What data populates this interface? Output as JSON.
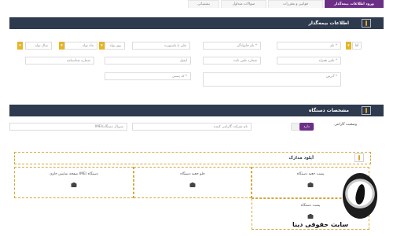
{
  "tabs": [
    {
      "label": "ورود اطلاعات بیمه‌گذار",
      "active": true
    },
    {
      "label": "قوانین و مقررات",
      "active": false
    },
    {
      "label": "سوالات متداول",
      "active": false
    },
    {
      "label": "پشتیبانی",
      "active": false
    }
  ],
  "insurer_section": {
    "title": "اطلاعات بیمه‌گذار",
    "row1": {
      "title_select": "آقا",
      "first_name": "نام *",
      "last_name": "نام خانوادگی *",
      "national_or_passport": "ملی یا پاسپورت",
      "birth_day": "روز تولد",
      "birth_month": "ماه تولد",
      "birth_year": "سال تولد"
    },
    "row2": {
      "mobile": "تلفن همراه *",
      "landline": "شماره تلفن ثابت",
      "email": "ایمیل",
      "id_number": "شماره شناسنامه"
    },
    "row3": {
      "address": "آدرس *",
      "postal_code": "کد پستی *"
    }
  },
  "device_section": {
    "title": "مشخصات دستگاه",
    "warranty_label": "وضعیت گارانتی",
    "warranty_value": "دارد",
    "warranty_company": "نام شرکت گارانتی کننده",
    "imei": "IMEI/سریال دستگاه"
  },
  "upload_section": {
    "title": "آپلود مدارک",
    "boxes": [
      "پشت جعبه دستگاه",
      "جلو جعبه دستگاه",
      "صفحه نمایش حاوی IMEI دستگاه",
      "پشت دستگاه"
    ]
  },
  "watermark": {
    "brand": "سایت حقوقی دینا"
  },
  "colors": {
    "header_bg": "#2e3a4e",
    "accent_purple": "#6b2f86",
    "accent_yellow": "#e5b52a"
  }
}
